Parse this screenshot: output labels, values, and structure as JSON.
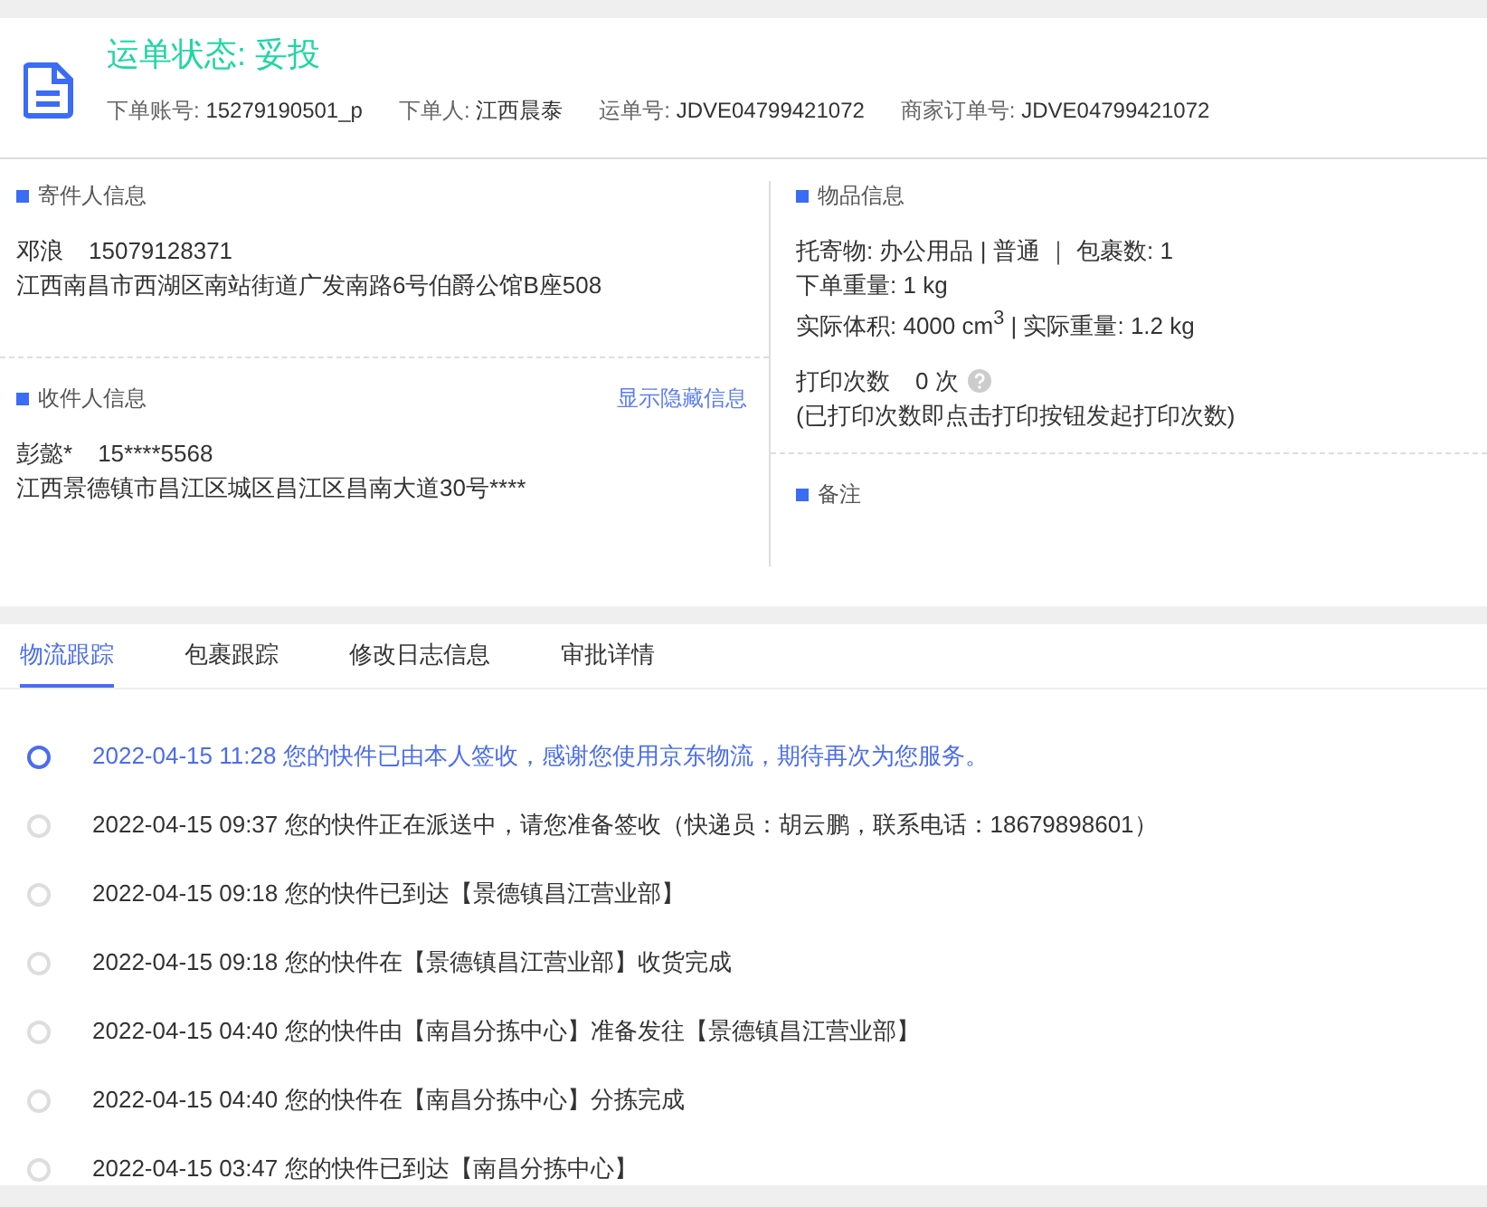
{
  "header": {
    "status": "运单状态: 妥投",
    "meta": [
      {
        "label": "下单账号:",
        "value": "15279190501_p"
      },
      {
        "label": "下单人:",
        "value": "江西晨泰"
      },
      {
        "label": "运单号:",
        "value": "JDVE04799421072"
      },
      {
        "label": "商家订单号:",
        "value": "JDVE04799421072"
      }
    ]
  },
  "sender": {
    "title": "寄件人信息",
    "name": "邓浪",
    "phone": "15079128371",
    "address": "江西南昌市西湖区南站街道广发南路6号伯爵公馆B座508"
  },
  "receiver": {
    "title": "收件人信息",
    "link": "显示隐藏信息",
    "name": "彭懿*",
    "phone": "15****5568",
    "address": "江西景德镇市昌江区城区昌江区昌南大道30号****"
  },
  "goods": {
    "title": "物品信息",
    "lines": [
      "托寄物:  办公用品 | 普通 ｜ 包裹数:  1",
      "下单重量:  1 kg",
      "实际体积:   4000 cm$^{3}$ | 实际重量:  1.2 kg"
    ],
    "print_label": "打印次数",
    "print_count": "0 次",
    "print_note": "(已打印次数即点击打印按钮发起打印次数)"
  },
  "remark": {
    "title": "备注"
  },
  "tabs": [
    {
      "label": "物流跟踪",
      "selected": true
    },
    {
      "label": "包裹跟踪",
      "selected": false
    },
    {
      "label": "修改日志信息",
      "selected": false
    },
    {
      "label": "审批详情",
      "selected": false
    }
  ],
  "events": [
    {
      "time": "2022-04-15 11:28",
      "text": "您的快件已由本人签收，感谢您使用京东物流，期待再次为您服务。",
      "current": true
    },
    {
      "time": "2022-04-15 09:37",
      "text": "您的快件正在派送中，请您准备签收（快递员：胡云鹏，联系电话：18679898601）",
      "current": false
    },
    {
      "time": "2022-04-15 09:18",
      "text": "您的快件已到达【景德镇昌江营业部】",
      "current": false
    },
    {
      "time": "2022-04-15 09:18",
      "text": "您的快件在【景德镇昌江营业部】收货完成",
      "current": false
    },
    {
      "time": "2022-04-15 04:40",
      "text": "您的快件由【南昌分拣中心】准备发往【景德镇昌江营业部】",
      "current": false
    },
    {
      "time": "2022-04-15 04:40",
      "text": "您的快件在【南昌分拣中心】分拣完成",
      "current": false
    },
    {
      "time": "2022-04-15 03:47",
      "text": "您的快件已到达【南昌分拣中心】",
      "current": false
    }
  ]
}
